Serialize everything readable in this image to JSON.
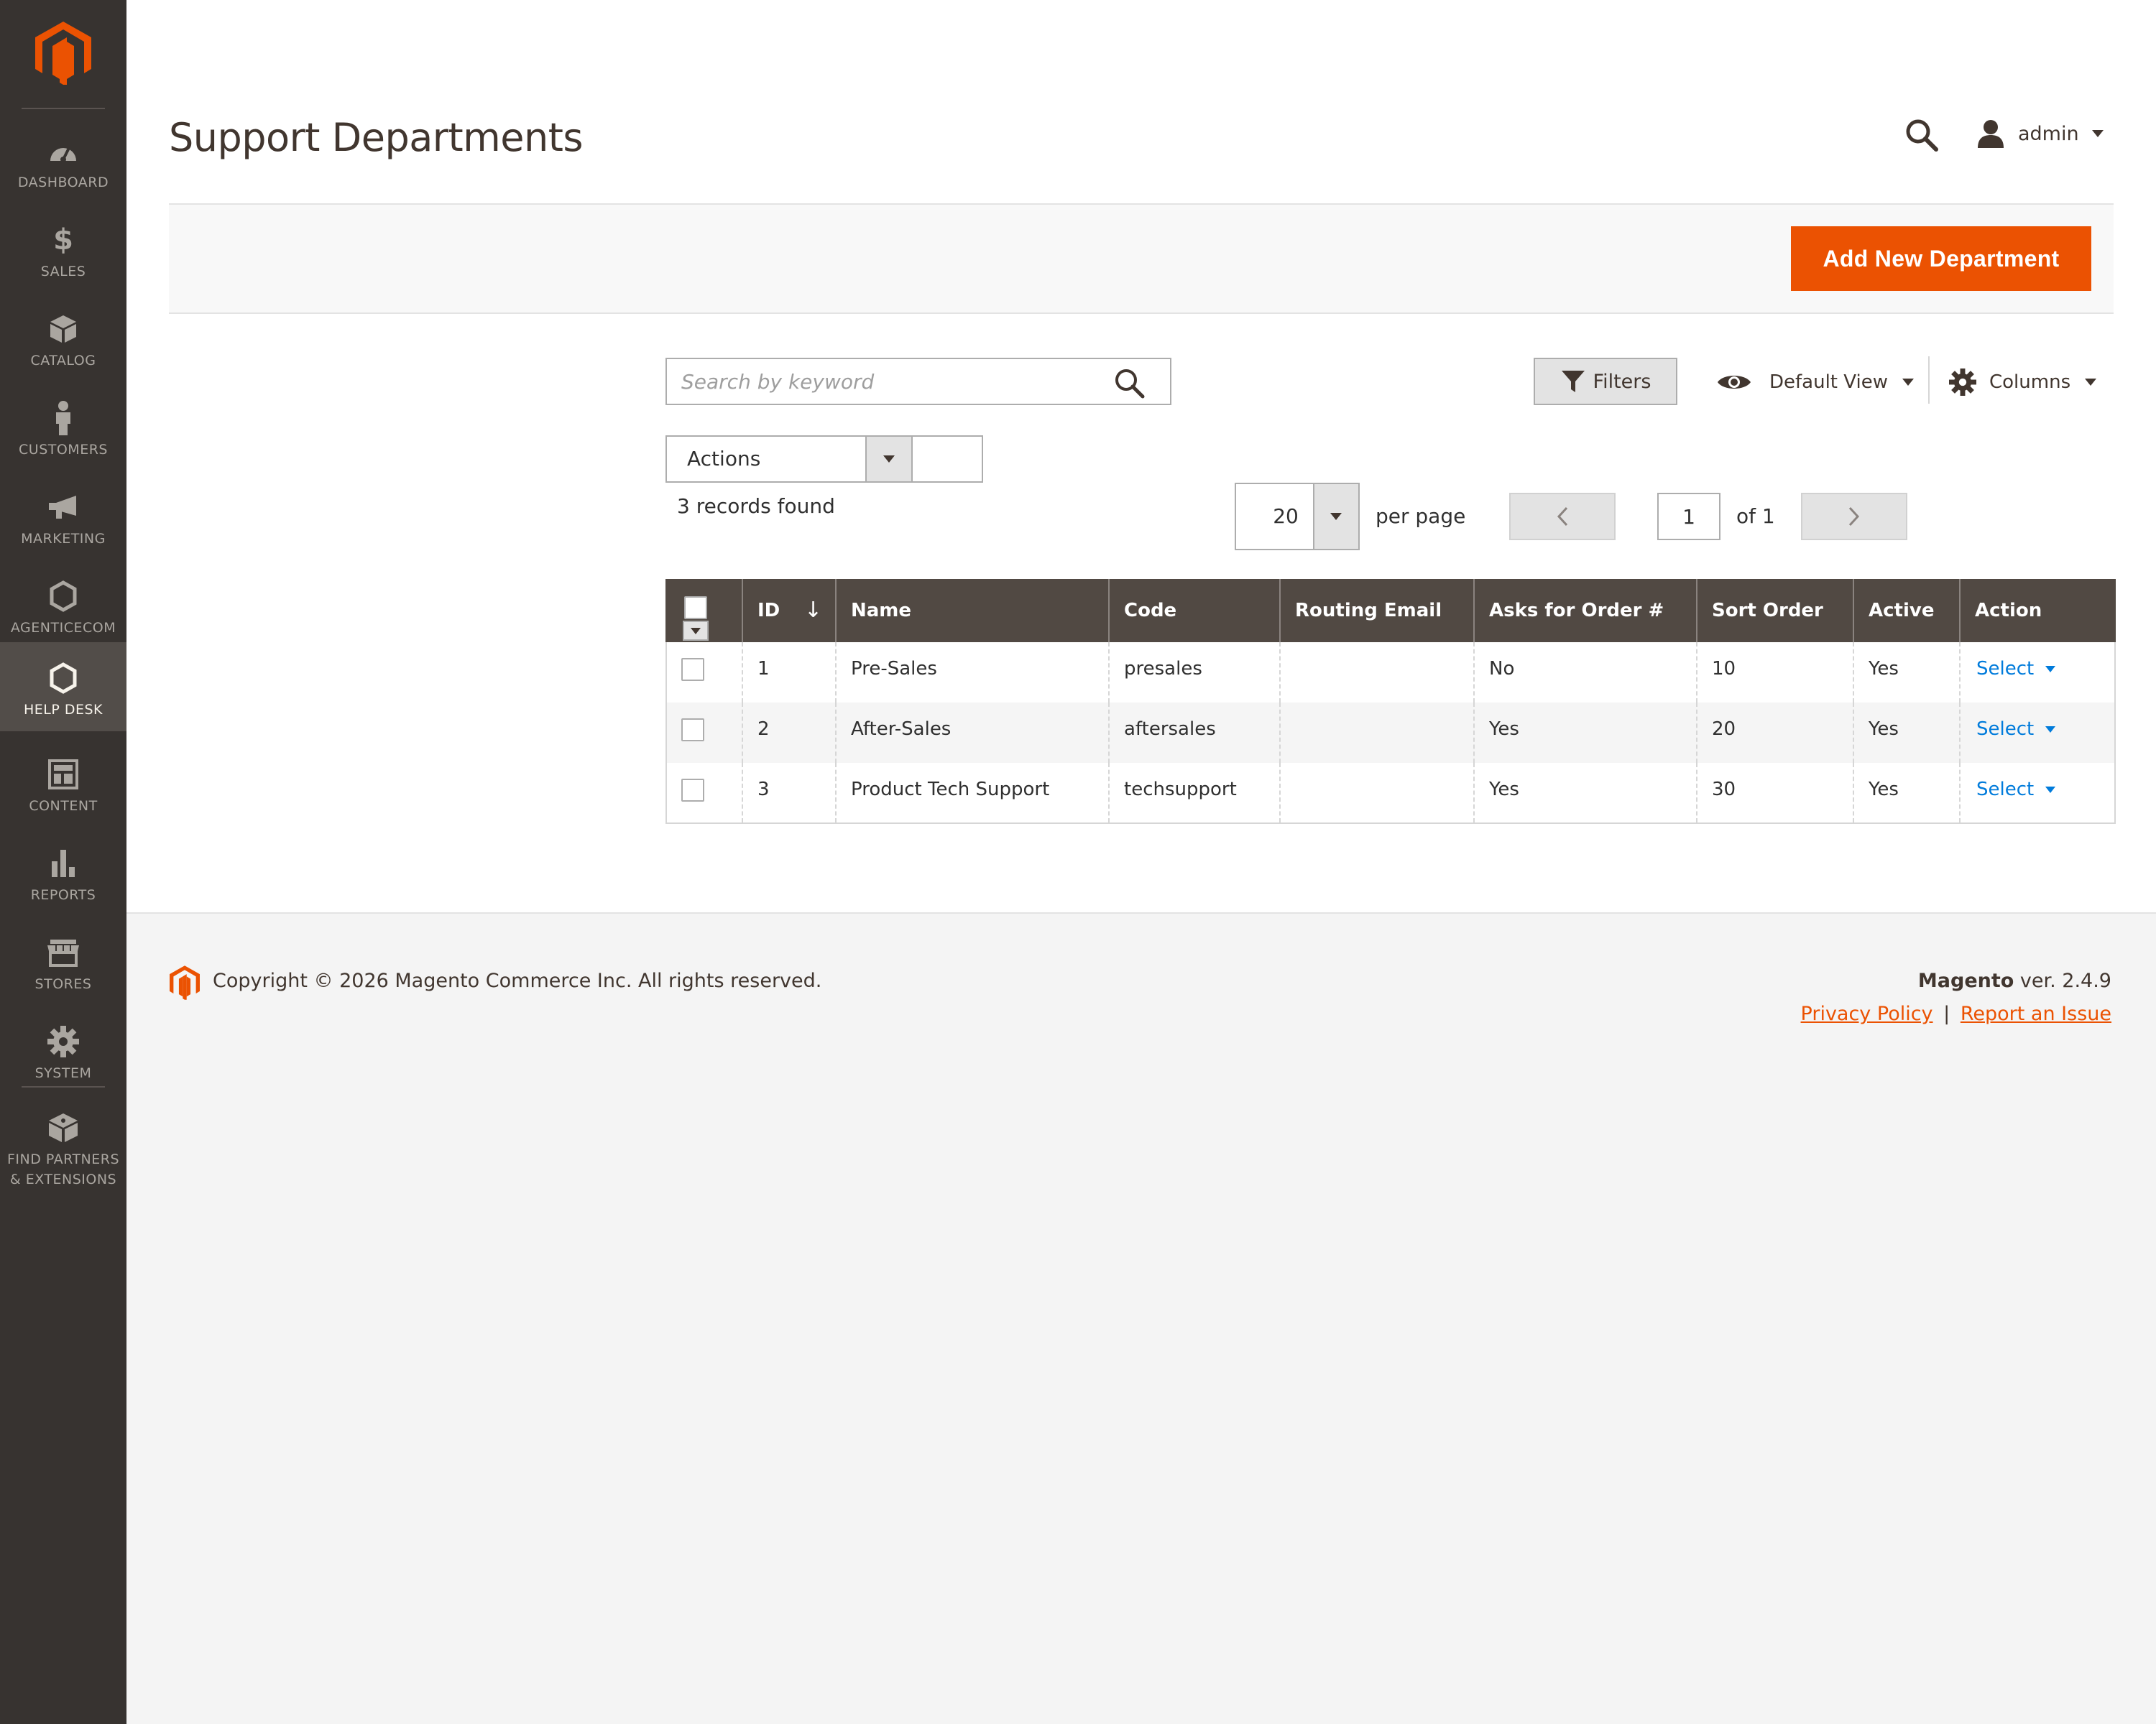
{
  "app": {
    "title": "Support Departments",
    "brand_color": "#eb5202",
    "sidebar_color": "#373330"
  },
  "sidebar": {
    "items": [
      {
        "label": "DASHBOARD",
        "icon": "speedometer-icon"
      },
      {
        "label": "SALES",
        "icon": "dollar-icon"
      },
      {
        "label": "CATALOG",
        "icon": "box-icon"
      },
      {
        "label": "CUSTOMERS",
        "icon": "person-icon"
      },
      {
        "label": "MARKETING",
        "icon": "megaphone-icon"
      },
      {
        "label": "AGENTICECOM",
        "icon": "hexagon-icon"
      },
      {
        "label": "HELP DESK",
        "icon": "hexagon-icon",
        "active": true
      },
      {
        "label": "CONTENT",
        "icon": "layout-icon"
      },
      {
        "label": "REPORTS",
        "icon": "bar-chart-icon"
      },
      {
        "label": "STORES",
        "icon": "store-icon"
      },
      {
        "label": "SYSTEM",
        "icon": "gear-icon"
      },
      {
        "label": "FIND PARTNERS",
        "label2": "& EXTENSIONS",
        "icon": "cube-icon"
      }
    ]
  },
  "header": {
    "user_name": "admin"
  },
  "page_actions": {
    "add_label": "Add New Department"
  },
  "toolbar": {
    "search_placeholder": "Search by keyword",
    "filters_label": "Filters",
    "view_label": "Default View",
    "columns_label": "Columns",
    "actions_label": "Actions",
    "records_found": "3 records found",
    "per_page_value": "20",
    "per_page_label": "per page",
    "current_page": "1",
    "page_of": "of 1"
  },
  "grid": {
    "columns": [
      "ID",
      "Name",
      "Code",
      "Routing Email",
      "Asks for Order #",
      "Sort Order",
      "Active",
      "Action"
    ],
    "rows": [
      {
        "id": "1",
        "name": "Pre-Sales",
        "code": "presales",
        "routing_email": "",
        "asks_order": "No",
        "sort_order": "10",
        "active": "Yes",
        "action": "Select"
      },
      {
        "id": "2",
        "name": "After-Sales",
        "code": "aftersales",
        "routing_email": "",
        "asks_order": "Yes",
        "sort_order": "20",
        "active": "Yes",
        "action": "Select"
      },
      {
        "id": "3",
        "name": "Product Tech Support",
        "code": "techsupport",
        "routing_email": "",
        "asks_order": "Yes",
        "sort_order": "30",
        "active": "Yes",
        "action": "Select"
      }
    ]
  },
  "footer": {
    "copyright": "Copyright © 2026 Magento Commerce Inc. All rights reserved.",
    "product": "Magento",
    "version": " ver. 2.4.9",
    "privacy_label": "Privacy Policy",
    "separator": "|",
    "report_label": "Report an Issue"
  }
}
